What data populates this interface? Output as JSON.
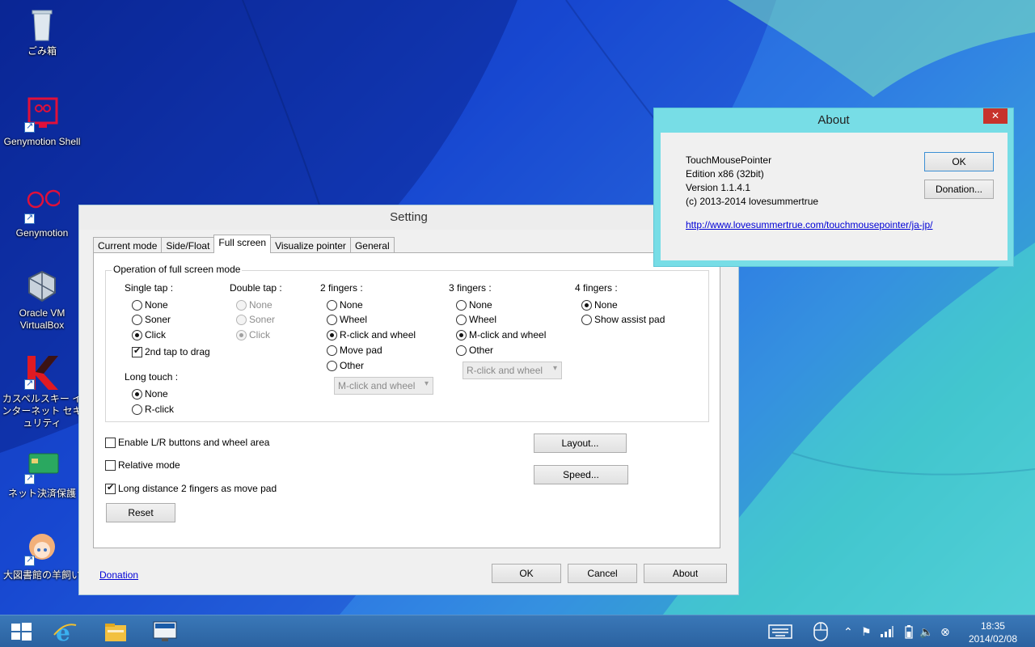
{
  "desktop": {
    "icons": [
      {
        "label": "ごみ箱",
        "icon": "recycle-bin-icon"
      },
      {
        "label": "Genymotion Shell",
        "icon": "genymotion-shell-icon"
      },
      {
        "label": "Genymotion",
        "icon": "genymotion-icon"
      },
      {
        "label": "Oracle VM VirtualBox",
        "icon": "virtualbox-icon"
      },
      {
        "label": "カスペルスキー インターネット セキュリティ",
        "icon": "kaspersky-icon"
      },
      {
        "label": "ネット決済保護",
        "icon": "safe-money-icon"
      },
      {
        "label": "大図書館の羊飼い",
        "icon": "game-character-icon"
      }
    ]
  },
  "setting": {
    "title": "Setting",
    "tabs": [
      "Current mode",
      "Side/Float",
      "Full screen",
      "Visualize pointer",
      "General"
    ],
    "active_tab": "Full screen",
    "group_title": "Operation of full screen mode",
    "single_tap": {
      "label": "Single tap :",
      "options": [
        "None",
        "Soner",
        "Click"
      ],
      "selected": "Click",
      "second_tap_drag": {
        "label": "2nd tap to drag",
        "checked": true
      }
    },
    "double_tap": {
      "label": "Double tap :",
      "options": [
        "None",
        "Soner",
        "Click"
      ],
      "selected": "Click",
      "disabled": true
    },
    "long_touch": {
      "label": "Long touch :",
      "options": [
        "None",
        "R-click"
      ],
      "selected": "None"
    },
    "two_fingers": {
      "label": "2 fingers :",
      "options": [
        "None",
        "Wheel",
        "R-click and wheel",
        "Move pad",
        "Other"
      ],
      "selected": "R-click and wheel",
      "other_value": "M-click and wheel"
    },
    "three_fingers": {
      "label": "3 fingers :",
      "options": [
        "None",
        "Wheel",
        "M-click and wheel",
        "Other"
      ],
      "selected": "M-click and wheel",
      "other_value": "R-click and wheel"
    },
    "four_fingers": {
      "label": "4 fingers :",
      "options": [
        "None",
        "Show assist pad"
      ],
      "selected": "None"
    },
    "checks": [
      {
        "label": "Enable L/R buttons and wheel area",
        "checked": false
      },
      {
        "label": "Relative mode",
        "checked": false
      },
      {
        "label": "Long distance 2 fingers as move pad",
        "checked": true
      }
    ],
    "reset_label": "Reset",
    "layout_label": "Layout...",
    "speed_label": "Speed...",
    "donation_link": "Donation",
    "ok_label": "OK",
    "cancel_label": "Cancel",
    "about_label": "About"
  },
  "about": {
    "title": "About",
    "close_label": "✕",
    "lines": [
      "TouchMousePointer",
      "Edition x86 (32bit)",
      "Version 1.1.4.1",
      "(c) 2013-2014 lovesummertrue"
    ],
    "url": "http://www.lovesummertrue.com/touchmousepointer/ja-jp/",
    "ok_label": "OK",
    "donation_label": "Donation..."
  },
  "taskbar": {
    "time": "18:35",
    "date": "2014/02/08",
    "pinned": [
      "windows-start-icon",
      "internet-explorer-icon",
      "file-explorer-icon",
      "lenovo-app-icon"
    ],
    "tray": [
      "keyboard-icon",
      "mouse-icon",
      "chevron-up-icon",
      "flag-icon",
      "signal-icon",
      "battery-icon",
      "volume-icon",
      "close-circle-icon"
    ],
    "colors": {
      "taskbar": "#2f6aa8",
      "about_accent": "#77dde6",
      "close_red": "#c7332c"
    }
  }
}
